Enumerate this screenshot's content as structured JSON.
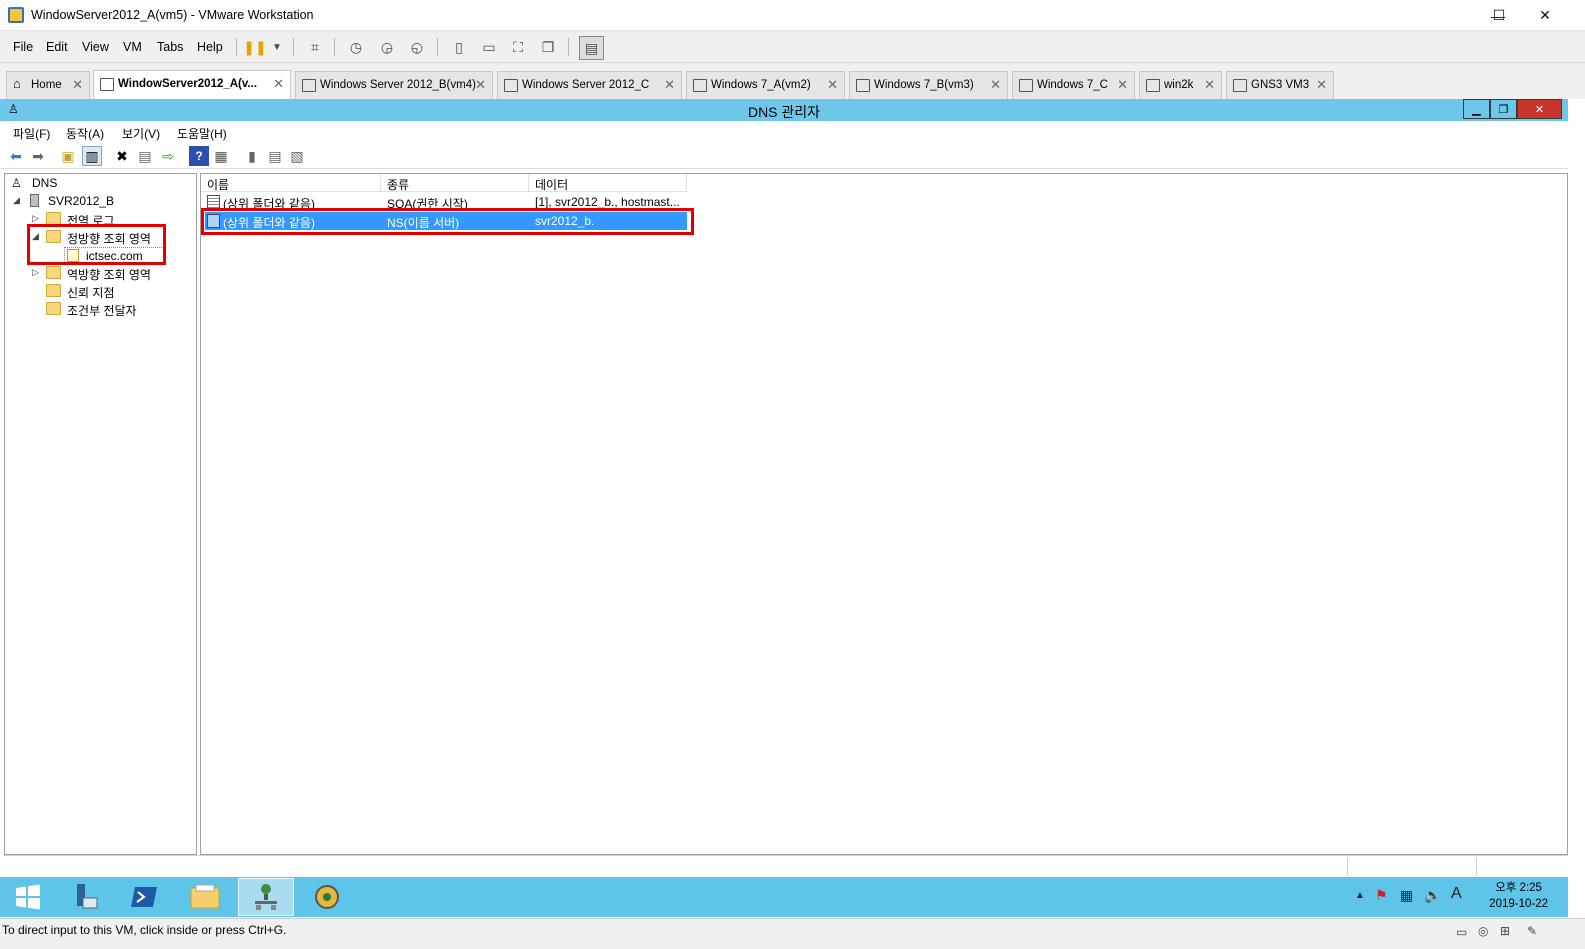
{
  "window": {
    "title": "WindowServer2012_A(vm5) - VMware Workstation",
    "minimize": "—",
    "maximize": "☐",
    "close": "✕"
  },
  "vm_menu": [
    "File",
    "Edit",
    "View",
    "VM",
    "Tabs",
    "Help"
  ],
  "vm_tabs": [
    {
      "label": "Home"
    },
    {
      "label": "WindowServer2012_A(v..."
    },
    {
      "label": "Windows Server 2012_B(vm4)"
    },
    {
      "label": "Windows Server 2012_C"
    },
    {
      "label": "Windows 7_A(vm2)"
    },
    {
      "label": "Windows 7_B(vm3)"
    },
    {
      "label": "Windows 7_C"
    },
    {
      "label": "win2k"
    },
    {
      "label": "GNS3 VM3"
    }
  ],
  "mmc": {
    "title": "DNS 관리자",
    "menu": [
      "파일(F)",
      "동작(A)",
      "보기(V)",
      "도움말(H)"
    ]
  },
  "tree": {
    "root": "DNS",
    "server": "SVR2012_B",
    "global_logs": "전역 로그",
    "forward_zones": "정방향 조회 영역",
    "zone": "ictsec.com",
    "reverse_zones": "역방향 조회 영역",
    "trust_points": "신뢰 지점",
    "conditional_forwarders": "조건부 전달자"
  },
  "list": {
    "columns": [
      "이름",
      "종류",
      "데이터"
    ],
    "rows": [
      {
        "name": "(상위 폴더와 같음)",
        "type": "SOA(권한 시작)",
        "data": "[1], svr2012_b., hostmast..."
      },
      {
        "name": "(상위 폴더와 같음)",
        "type": "NS(이름 서버)",
        "data": "svr2012_b."
      }
    ],
    "selected_row": 1
  },
  "taskbar": {
    "time_ampm": "오후 2:25",
    "date": "2019-10-22",
    "ime": "A"
  },
  "vm_status": {
    "message": "To direct input to this VM, click inside or press Ctrl+G."
  }
}
